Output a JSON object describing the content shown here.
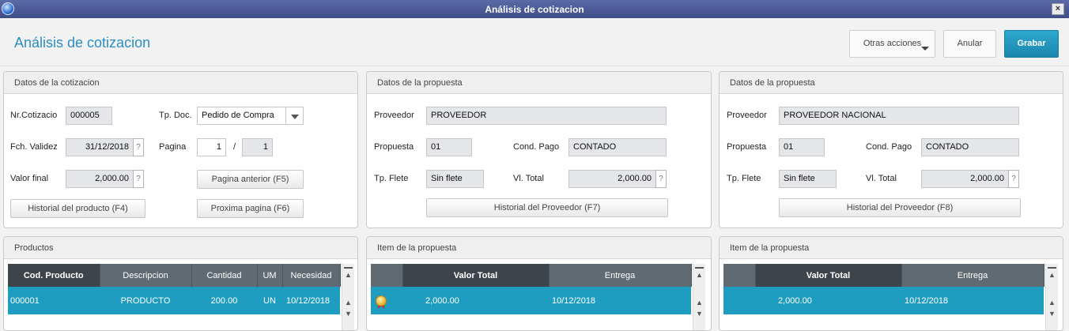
{
  "window": {
    "title": "Análisis de cotizacion",
    "close_glyph": "×"
  },
  "header": {
    "page_title": "Análisis de cotizacion",
    "buttons": {
      "more": "Otras acciones",
      "cancel": "Anular",
      "save": "Grabar"
    }
  },
  "quote_panel": {
    "title": "Datos de la cotizacion",
    "nr_label": "Nr.Cotizacio",
    "nr_value": "000005",
    "tp_doc_label": "Tp. Doc.",
    "tp_doc_value": "Pedido de Compra",
    "fch_label": "Fch. Validez",
    "fch_value": "31/12/2018",
    "pagina_label": "Pagina",
    "pagina_current": "1",
    "pagina_sep": "/",
    "pagina_total": "1",
    "valor_label": "Valor final",
    "valor_value": "2,000.00",
    "help_glyph": "?",
    "prev_page_button": "Pagina anterior (F5)",
    "history_product_button": "Historial del producto (F4)",
    "next_page_button": "Proxima pagina (F6)"
  },
  "proposal_panels": [
    {
      "title": "Datos de la propuesta",
      "proveedor_label": "Proveedor",
      "proveedor_value": "PROVEEDOR",
      "propuesta_label": "Propuesta",
      "propuesta_value": "01",
      "cond_label": "Cond. Pago",
      "cond_value": "CONTADO",
      "flete_label": "Tp. Flete",
      "flete_value": "Sin flete",
      "total_label": "Vl. Total",
      "total_value": "2,000.00",
      "history_button": "Historial del Proveedor (F7)"
    },
    {
      "title": "Datos de la propuesta",
      "proveedor_label": "Proveedor",
      "proveedor_value": "PROVEEDOR NACIONAL",
      "propuesta_label": "Propuesta",
      "propuesta_value": "01",
      "cond_label": "Cond. Pago",
      "cond_value": "CONTADO",
      "flete_label": "Tp. Flete",
      "flete_value": "Sin flete",
      "total_label": "Vl. Total",
      "total_value": "2,000.00",
      "history_button": "Historial del Proveedor (F8)"
    }
  ],
  "products_panel": {
    "title": "Productos",
    "columns": [
      "Cod. Producto",
      "Descripcion",
      "Cantidad",
      "UM",
      "Necesidad"
    ],
    "rows": [
      {
        "code": "000001",
        "desc": "PRODUCTO",
        "qty": "200.00",
        "um": "UN",
        "need": "10/12/2018"
      }
    ]
  },
  "item_panels": [
    {
      "title": "Item de la propuesta",
      "columns": [
        "",
        "Valor Total",
        "Entrega"
      ],
      "rows": [
        {
          "icon": "winner-medal-icon",
          "total": "2,000.00",
          "delivery": "10/12/2018"
        }
      ]
    },
    {
      "title": "Item de la propuesta",
      "columns": [
        "",
        "Valor Total",
        "Entrega"
      ],
      "rows": [
        {
          "total": "2,000.00",
          "delivery": "10/12/2018"
        }
      ]
    }
  ],
  "colors": {
    "accent": "#1e9dc0",
    "title_bar": "#3e4c88",
    "grid_header": "#5f6a72",
    "page_title": "#2a8fc0"
  }
}
